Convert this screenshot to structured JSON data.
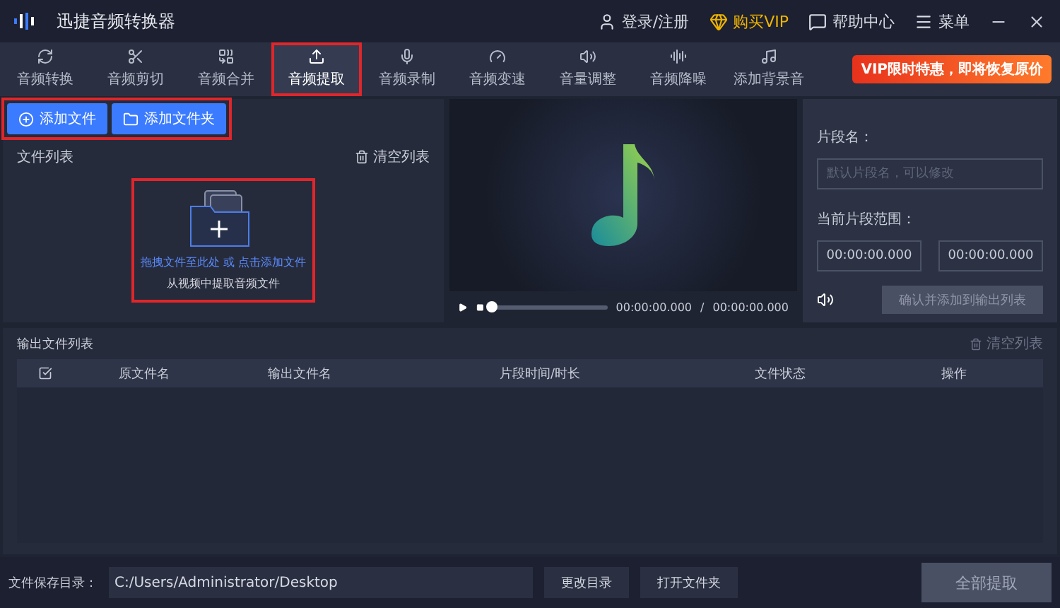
{
  "window": {
    "title": "迅捷音频转换器"
  },
  "header_links": [
    {
      "kind": "user",
      "label": "登录/注册"
    },
    {
      "kind": "vip",
      "label": "购买VIP"
    },
    {
      "kind": "help",
      "label": "帮助中心"
    },
    {
      "kind": "menu",
      "label": "菜单"
    }
  ],
  "tabs": [
    {
      "kind": "convert",
      "label": "音频转换",
      "selected": false,
      "highlighted": false
    },
    {
      "kind": "cut",
      "label": "音频剪切",
      "selected": false,
      "highlighted": false
    },
    {
      "kind": "merge",
      "label": "音频合并",
      "selected": false,
      "highlighted": false
    },
    {
      "kind": "extract",
      "label": "音频提取",
      "selected": true,
      "highlighted": true
    },
    {
      "kind": "mic",
      "label": "音频录制",
      "selected": false,
      "highlighted": false
    },
    {
      "kind": "speed",
      "label": "音频变速",
      "selected": false,
      "highlighted": false
    },
    {
      "kind": "volume",
      "label": "音量调整",
      "selected": false,
      "highlighted": false
    },
    {
      "kind": "noise",
      "label": "音频降噪",
      "selected": false,
      "highlighted": false
    },
    {
      "kind": "note",
      "label": "添加背景音",
      "selected": false,
      "highlighted": false
    }
  ],
  "promo": "VIP限时特惠，即将恢复原价",
  "toolbar": {
    "highlighted": true,
    "buttons": [
      {
        "kind": "file",
        "label": "添加文件"
      },
      {
        "kind": "folder",
        "label": "添加文件夹"
      }
    ]
  },
  "file_list": {
    "title": "文件列表",
    "clear": "清空列表",
    "drop_zone": {
      "highlighted": true,
      "hint": "拖拽文件至此处 或 点击添加文件",
      "caption": "从视频中提取音频文件"
    }
  },
  "player": {
    "current": "00:00:00.000",
    "separator": "/",
    "total": "00:00:00.000",
    "level": 0
  },
  "segment": {
    "name_label": "片段名：",
    "name_placeholder": "默认片段名，可以修改",
    "range_label": "当前片段范围：",
    "start": "00:00:00.000",
    "end": "00:00:00.000",
    "confirm": "确认并添加到输出列表"
  },
  "output": {
    "title": "输出文件列表",
    "clear": "清空列表",
    "columns": [
      "原文件名",
      "输出文件名",
      "片段时间/时长",
      "文件状态",
      "操作"
    ],
    "all_checked": true
  },
  "footer": {
    "label": "文件保存目录：",
    "path": "C:/Users/Administrator/Desktop",
    "change": "更改目录",
    "open": "打开文件夹",
    "extract_all": "全部提取"
  }
}
